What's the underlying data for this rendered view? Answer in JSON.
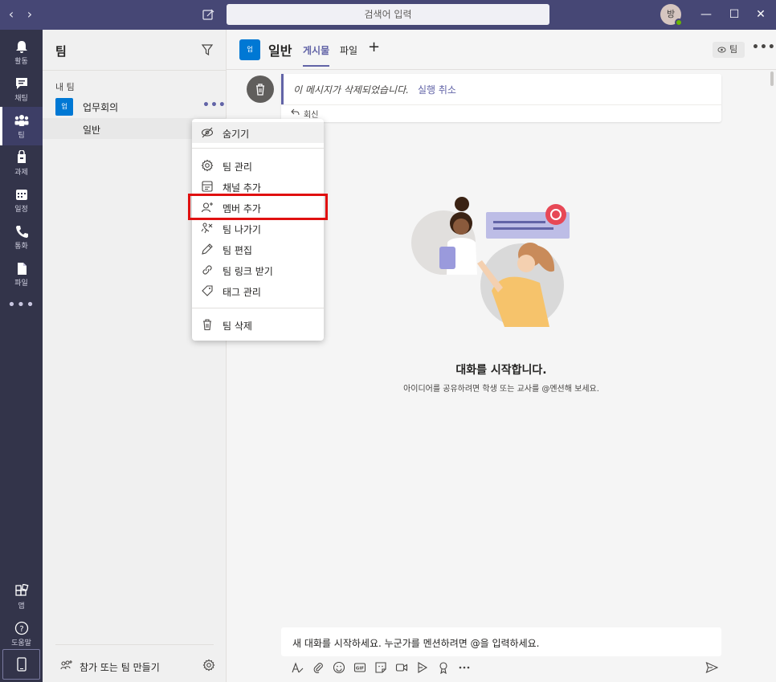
{
  "titlebar": {
    "back": "‹",
    "forward": "›",
    "search_placeholder": "검색어 입력",
    "avatar_initial": "방",
    "minimize": "—",
    "maximize": "☐",
    "close": "✕"
  },
  "rail": {
    "items": [
      {
        "label": "활동",
        "icon": "bell-icon"
      },
      {
        "label": "채팅",
        "icon": "chat-icon"
      },
      {
        "label": "팀",
        "icon": "teams-icon"
      },
      {
        "label": "과제",
        "icon": "assignments-icon"
      },
      {
        "label": "일정",
        "icon": "calendar-icon"
      },
      {
        "label": "통화",
        "icon": "phone-icon"
      },
      {
        "label": "파일",
        "icon": "file-icon"
      }
    ],
    "more": "•••",
    "apps_label": "앱",
    "help_label": "도움말"
  },
  "teams_panel": {
    "title": "팀",
    "section": "내 팀",
    "team": {
      "tile": "업",
      "name": "업무회의",
      "more": "•••"
    },
    "channel": "일반",
    "join_label": "참가 또는 팀 만들기"
  },
  "channel": {
    "tile": "업",
    "title": "일반",
    "tabs": [
      "게시물",
      "파일"
    ],
    "add": "+",
    "team_button": "팀",
    "more": "•••"
  },
  "deleted": {
    "message": "이 메시지가 삭제되었습니다.",
    "undo": "실행 취소",
    "reply": "회신"
  },
  "empty": {
    "title": "대화를 시작합니다.",
    "subtitle": "아이디어를 공유하려면 학생 또는 교사를 @멘션해 보세요."
  },
  "compose": {
    "placeholder": "새 대화를 시작하세요. 누군가를 멘션하려면 @을 입력하세요."
  },
  "menu": {
    "items": [
      {
        "label": "숨기기",
        "icon": "hide-icon"
      },
      {
        "label": "팀 관리",
        "icon": "gear-icon"
      },
      {
        "label": "채널 추가",
        "icon": "add-channel-icon"
      },
      {
        "label": "멤버 추가",
        "icon": "add-member-icon"
      },
      {
        "label": "팀 나가기",
        "icon": "leave-icon"
      },
      {
        "label": "팀 편집",
        "icon": "pencil-icon"
      },
      {
        "label": "팀 링크 받기",
        "icon": "link-icon"
      },
      {
        "label": "태그 관리",
        "icon": "tag-icon"
      },
      {
        "label": "팀 삭제",
        "icon": "trash-icon"
      }
    ]
  },
  "colors": {
    "titlebar": "#464775",
    "rail": "#33344a",
    "accent": "#6264a7",
    "team_tile": "#0078d4",
    "highlight": "#e01010"
  }
}
